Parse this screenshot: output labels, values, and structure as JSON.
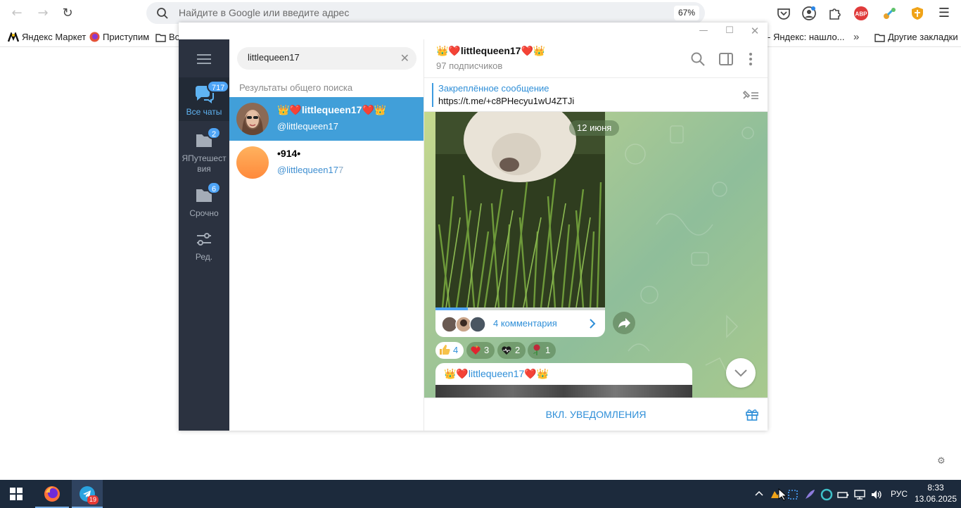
{
  "browser": {
    "omnibox_placeholder": "Найдите в Google или введите адрес",
    "zoom": "67%",
    "bookmarks": [
      {
        "label": "Яндекс Маркет"
      },
      {
        "label": "Приступим"
      },
      {
        "label": "Вс"
      },
      {
        "label": "- Яндекс: нашло..."
      },
      {
        "label": "Другие закладки"
      }
    ]
  },
  "telegram": {
    "folders": [
      {
        "label": "Все чаты",
        "badge": "717",
        "active": true
      },
      {
        "label": "ЯПутешествия",
        "badge": "2"
      },
      {
        "label": "Срочно",
        "badge": "6"
      },
      {
        "label": "Ред."
      }
    ],
    "search": {
      "value": "littlequeen17"
    },
    "section_title": "Результаты общего поиска",
    "results": [
      {
        "name": "👑❤️littlequeen17❤️👑",
        "username": "@littlequeen17",
        "active": true
      },
      {
        "name": "•914•",
        "username": "@littlequeen17",
        "username_tail": "7"
      }
    ],
    "chat": {
      "title": "👑❤️littlequeen17❤️👑",
      "subscribers": "97 подписчиков",
      "pinned_title": "Закреплённое сообщение",
      "pinned_text": "https://t.me/+c8PHecyu1wU4ZTJi",
      "date_pill": "12 июня",
      "media_progress": 0.19,
      "comments_label": "4 комментария",
      "reactions": [
        {
          "emoji": "thumbs-up",
          "count": "4",
          "mine": true
        },
        {
          "emoji": "heart-fire",
          "count": "3"
        },
        {
          "emoji": "black-heart",
          "count": "2"
        },
        {
          "emoji": "rose",
          "count": "1"
        }
      ],
      "next_author": "👑❤️littlequeen17❤️👑",
      "footer_button": "ВКЛ. УВЕДОМЛЕНИЯ"
    }
  },
  "taskbar": {
    "telegram_badge": "19",
    "lang": "РУС",
    "time": "8:33",
    "date": "13.06.2025"
  },
  "colors": {
    "accent": "#419fd9",
    "sidebar": "#2b3240",
    "taskbar": "#1c2a3c"
  }
}
